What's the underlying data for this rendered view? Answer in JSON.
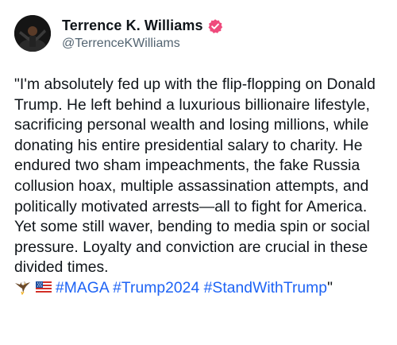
{
  "author": {
    "display_name": "Terrence K. Williams",
    "handle": "@TerrenceKWilliams",
    "verified": true,
    "verified_badge_color": "#ef4a7c"
  },
  "post": {
    "text": "\"I'm absolutely fed up with the flip-flopping on Donald Trump. He left behind a luxurious billionaire lifestyle, sacrificing personal wealth and losing millions, while donating his entire presidential salary to charity. He endured two sham impeachments, the fake Russia collusion hoax, multiple assassination attempts, and politically motivated arrests—all to fight for America. Yet some still waver, bending to media spin or social pressure. Loyalty and conviction are crucial in these divided times.",
    "emojis": [
      "eagle",
      "us-flag"
    ],
    "hashtags": [
      "#MAGA",
      "#Trump2024",
      "#StandWithTrump"
    ],
    "closing_quote": "\"",
    "hashtag_color": "#1d63f5"
  }
}
